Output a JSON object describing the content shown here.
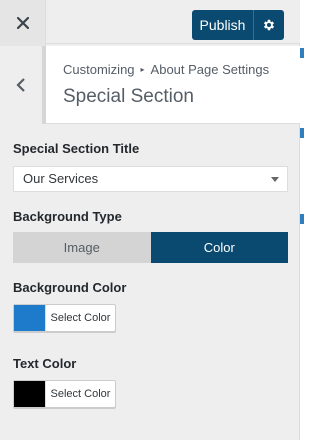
{
  "header": {
    "close_icon": "close-icon",
    "publish_label": "Publish",
    "settings_icon": "gear-icon",
    "accent": "#0b4a70"
  },
  "section": {
    "breadcrumb_root": "Customizing",
    "breadcrumb_sep": "▸",
    "breadcrumb_parent": "About Page Settings",
    "title": "Special Section"
  },
  "controls": {
    "special_title": {
      "label": "Special Section Title",
      "value": "Our Services"
    },
    "background_type": {
      "label": "Background Type",
      "options": [
        "Image",
        "Color"
      ],
      "selected": "Color"
    },
    "background_color": {
      "label": "Background Color",
      "button_text": "Select Color",
      "swatch": "#1e7acb"
    },
    "text_color": {
      "label": "Text Color",
      "button_text": "Select Color",
      "swatch": "#000000"
    }
  }
}
